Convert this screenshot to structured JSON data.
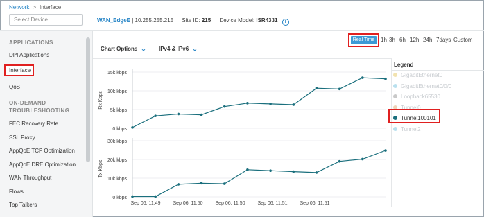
{
  "breadcrumb": {
    "root": "Network",
    "separator": ">",
    "current": "Interface"
  },
  "device_select": {
    "placeholder": "Select Device"
  },
  "device_info": {
    "host": "WAN_EdgeE",
    "ip_part": " | 10.255.255.215",
    "site_label": "Site ID:",
    "site_value": "215",
    "model_label": "Device Model:",
    "model_value": "ISR4331"
  },
  "sidebar": {
    "section1": "APPLICATIONS",
    "item_dpi": "DPI Applications",
    "item_interface": "Interface",
    "item_qos": "QoS",
    "section2_line1": "ON-DEMAND",
    "section2_line2": "TROUBLESHOOTING",
    "item_fec": "FEC Recovery Rate",
    "item_ssl": "SSL Proxy",
    "item_appqoe_tcp": "AppQoE TCP Optimization",
    "item_appqoe_dre": "AppQoE DRE Optimization",
    "item_wan": "WAN Throughput",
    "item_flows": "Flows",
    "item_talkers": "Top Talkers"
  },
  "toolbar": {
    "chart_options": "Chart Options",
    "ip_filter": "IPv4 & IPv6"
  },
  "time_ranges": {
    "real_time": "Real Time",
    "r1h": "1h",
    "r3h": "3h",
    "r6h": "6h",
    "r12h": "12h",
    "r24h": "24h",
    "r7days": "7days",
    "custom": "Custom"
  },
  "legend": {
    "title": "Legend",
    "items": [
      {
        "label": "GigabitEthernet0",
        "color": "#f2e3b0",
        "active": false
      },
      {
        "label": "GigabitEthernet0/0/0",
        "color": "#b9e0ee",
        "active": false
      },
      {
        "label": "Loopback65530",
        "color": "#c9c9c9",
        "active": false
      },
      {
        "label": "Tunnel0",
        "color": "#efd3b8",
        "active": false
      },
      {
        "label": "Tunnel100101",
        "color": "#1a6f7d",
        "active": true
      },
      {
        "label": "Tunnel2",
        "color": "#b9e0ee",
        "active": false
      }
    ]
  },
  "colors": {
    "accent": "#1e80c4",
    "series": "#1a6f7d",
    "highlight": "#e02020",
    "realtime_button": "#3c9ad6"
  },
  "chart_data": [
    {
      "type": "line",
      "ylabel": "Rx Kbps",
      "ylim": [
        0,
        15000
      ],
      "yticks": [
        "0 kbps",
        "5k kbps",
        "10k kbps",
        "15k kbps"
      ],
      "series": [
        {
          "name": "Tunnel100101",
          "values": [
            200,
            3300,
            3800,
            3600,
            5800,
            6700,
            6500,
            6300,
            10700,
            10500,
            13500,
            13200
          ]
        }
      ]
    },
    {
      "type": "line",
      "ylabel": "Tx Kbps",
      "ylim": [
        0,
        30000
      ],
      "yticks": [
        "0 kbps",
        "10k kbps",
        "20k kbps",
        "30k kbps"
      ],
      "xticks": [
        "Sep 06, 11:49",
        "Sep 06, 11:50",
        "Sep 06, 11:50",
        "Sep 06, 11:51",
        "Sep 06, 11:51"
      ],
      "series": [
        {
          "name": "Tunnel100101",
          "values": [
            200,
            200,
            6700,
            7300,
            7000,
            14500,
            14000,
            13500,
            13000,
            19000,
            20200,
            24800
          ]
        }
      ]
    }
  ]
}
